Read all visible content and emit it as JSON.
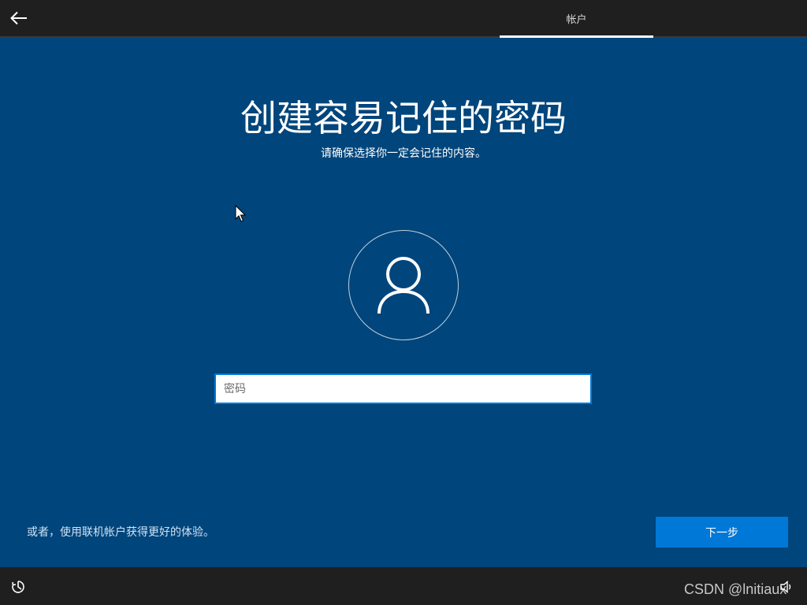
{
  "header": {
    "back_icon": "arrow-left-icon",
    "tab_label": "帐户"
  },
  "main": {
    "title": "创建容易记住的密码",
    "subtitle": "请确保选择你一定会记住的内容。",
    "avatar_icon": "user-icon",
    "password_placeholder": "密码",
    "password_value": ""
  },
  "footer": {
    "online_account_link": "或者，使用联机帐户获得更好的体验。",
    "next_label": "下一步",
    "accessibility_icon": "ease-of-access-icon",
    "volume_icon": "volume-icon",
    "watermark": "CSDN @lnitiaux"
  },
  "colors": {
    "background": "#00457b",
    "bar": "#1f1f1f",
    "accent": "#0078d7"
  }
}
